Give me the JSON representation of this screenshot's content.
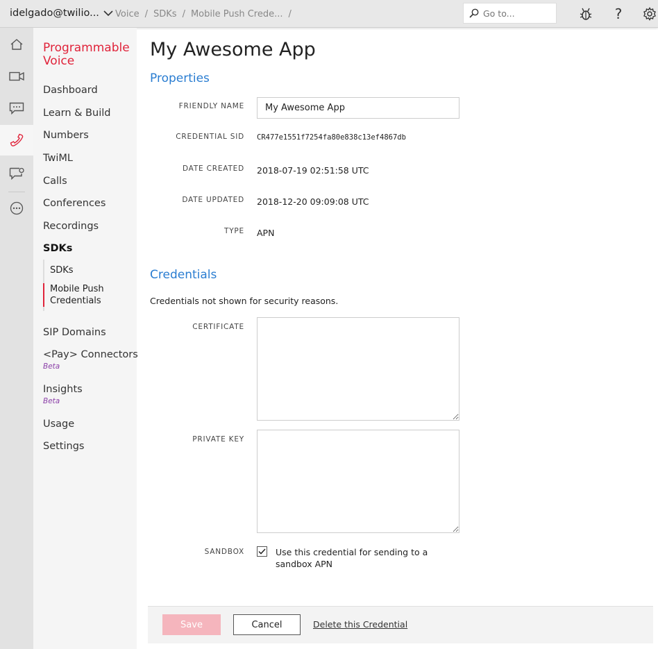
{
  "topbar": {
    "account": "idelgado@twilio...",
    "breadcrumbs": [
      "Voice",
      "SDKs",
      "Mobile Push Crede..."
    ],
    "breadcrumb_sep": "/",
    "search_placeholder": "Go to...",
    "help_glyph": "?"
  },
  "sidenav": {
    "product_line1": "Programmable",
    "product_line2": "Voice",
    "items": [
      "Dashboard",
      "Learn & Build",
      "Numbers",
      "TwiML",
      "Calls",
      "Conferences",
      "Recordings",
      "SDKs"
    ],
    "sub_items": [
      "SDKs",
      "Mobile Push Credentials"
    ],
    "items_after": [
      "SIP Domains",
      "<Pay> Connectors",
      "Insights",
      "Usage",
      "Settings"
    ],
    "beta": "Beta"
  },
  "main": {
    "title": "My Awesome App",
    "properties_title": "Properties",
    "friendly_name_label": "FRIENDLY NAME",
    "friendly_name_value": "My Awesome App",
    "credential_sid_label": "CREDENTIAL SID",
    "credential_sid_value": "CR477e1551f7254fa80e838c13ef4867db",
    "date_created_label": "DATE CREATED",
    "date_created_value": "2018-07-19 02:51:58 UTC",
    "date_updated_label": "DATE UPDATED",
    "date_updated_value": "2018-12-20 09:09:08 UTC",
    "type_label": "TYPE",
    "type_value": "APN",
    "credentials_title": "Credentials",
    "credentials_note": "Credentials not shown for security reasons.",
    "certificate_label": "CERTIFICATE",
    "private_key_label": "PRIVATE KEY",
    "sandbox_label": "SANDBOX",
    "sandbox_text": "Use this credential for sending to a sandbox APN",
    "sandbox_checked": true
  },
  "footer": {
    "save": "Save",
    "cancel": "Cancel",
    "delete": "Delete this Credential"
  },
  "colors": {
    "brand_red": "#e0243b",
    "link_blue": "#2a7dd1",
    "beta_purple": "#8b3fa8"
  }
}
